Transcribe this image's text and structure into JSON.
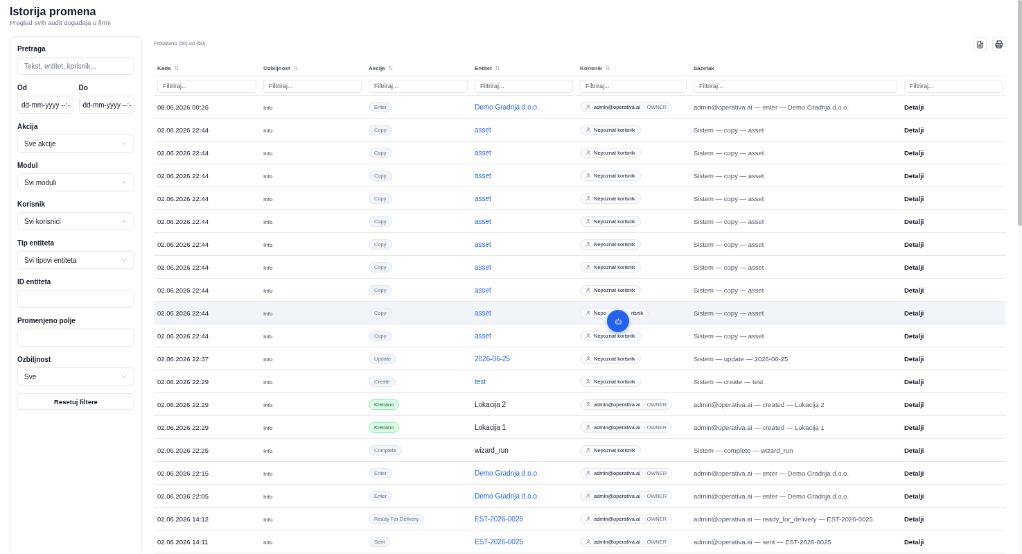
{
  "page": {
    "title": "Istorija promena",
    "subtitle": "Pregled svih audit događaja u firmi"
  },
  "filters": {
    "fields": [
      {
        "kind": "text",
        "label": "Pretraga",
        "placeholder": "Tekst, entitet, korisnik..."
      },
      {
        "kind": "date-pair",
        "items": [
          {
            "label": "Od",
            "value": "dd-mm-yyyy --:-"
          },
          {
            "label": "Do",
            "value": "dd-mm-yyyy --:-"
          }
        ]
      },
      {
        "kind": "select",
        "label": "Akcija",
        "value": "Sve akcije"
      },
      {
        "kind": "select",
        "label": "Modul",
        "value": "Svi moduli"
      },
      {
        "kind": "select",
        "label": "Korisnik",
        "value": "Svi korisnici"
      },
      {
        "kind": "select",
        "label": "Tip entiteta",
        "value": "Svi tipovi entiteta"
      },
      {
        "kind": "text",
        "label": "ID entiteta"
      },
      {
        "kind": "text",
        "label": "Promenjeno polje"
      },
      {
        "kind": "select",
        "label": "Ozbiljnost",
        "value": "Sve"
      }
    ],
    "reset_button": "Resetuj filtere"
  },
  "table": {
    "count_text": "Prikazano (50) od (50)",
    "columns": [
      {
        "label": "Kada",
        "sortable": true
      },
      {
        "label": "Ozbiljnost",
        "sortable": true
      },
      {
        "label": "Akcija",
        "sortable": true
      },
      {
        "label": "Entitet",
        "sortable": true
      },
      {
        "label": "Korisnik",
        "sortable": true
      },
      {
        "label": "Sažetak",
        "sortable": false
      }
    ],
    "filter_placeholders": [
      "Filtriraj...",
      "Filtriraj...",
      "Filtriraj...",
      "Filtriraj...",
      "Filtriraj...",
      "Filtriraj...",
      "Filtriraj..."
    ],
    "rows": [
      {
        "when": "08.06.2026 00:26",
        "severity": "Info",
        "action": {
          "label": "Enter",
          "color": "#f1f5f9"
        },
        "entity": {
          "text": "Demo Gradnja d.o.o.",
          "link": true
        },
        "user": "admin@operativa.ai",
        "role": "· OWNER",
        "summary": "admin@operativa.ai — enter — Demo Gradnja d.o.o.",
        "details": "Detalji",
        "hovered": false
      },
      {
        "when": "02.06.2026 22:44",
        "severity": "Info",
        "action": {
          "label": "Copy",
          "color": "#f1f5f9"
        },
        "entity": {
          "text": "asset",
          "link": true
        },
        "user": "Nepoznat korisnik",
        "summary": "Sistem — copy — asset",
        "details": "Detalji",
        "hovered": false
      },
      {
        "when": "02.06.2026 22:44",
        "severity": "Info",
        "action": {
          "label": "Copy",
          "color": "#f1f5f9"
        },
        "entity": {
          "text": "asset",
          "link": true
        },
        "user": "Nepoznat korisnik",
        "summary": "Sistem — copy — asset",
        "details": "Detalji",
        "hovered": false
      },
      {
        "when": "02.06.2026 22:44",
        "severity": "Info",
        "action": {
          "label": "Copy",
          "color": "#f1f5f9"
        },
        "entity": {
          "text": "asset",
          "link": true
        },
        "user": "Nepoznat korisnik",
        "summary": "Sistem — copy — asset",
        "details": "Detalji",
        "hovered": false
      },
      {
        "when": "02.06.2026 22:44",
        "severity": "Info",
        "action": {
          "label": "Copy",
          "color": "#f1f5f9"
        },
        "entity": {
          "text": "asset",
          "link": true
        },
        "user": "Nepoznat korisnik",
        "summary": "Sistem — copy — asset",
        "details": "Detalji",
        "hovered": false
      },
      {
        "when": "02.06.2026 22:44",
        "severity": "Info",
        "action": {
          "label": "Copy",
          "color": "#f1f5f9"
        },
        "entity": {
          "text": "asset",
          "link": true
        },
        "user": "Nepoznat korisnik",
        "summary": "Sistem — copy — asset",
        "details": "Detalji",
        "hovered": false
      },
      {
        "when": "02.06.2026 22:44",
        "severity": "Info",
        "action": {
          "label": "Copy",
          "color": "#f1f5f9"
        },
        "entity": {
          "text": "asset",
          "link": true
        },
        "user": "Nepoznat korisnik",
        "summary": "Sistem — copy — asset",
        "details": "Detalji",
        "hovered": false
      },
      {
        "when": "02.06.2026 22:44",
        "severity": "Info",
        "action": {
          "label": "Copy",
          "color": "#f1f5f9"
        },
        "entity": {
          "text": "asset",
          "link": true
        },
        "user": "Nepoznat korisnik",
        "summary": "Sistem — copy — asset",
        "details": "Detalji",
        "hovered": false
      },
      {
        "when": "02.06.2026 22:44",
        "severity": "Info",
        "action": {
          "label": "Copy",
          "color": "#f1f5f9"
        },
        "entity": {
          "text": "asset",
          "link": true
        },
        "user": "Nepoznat korisnik",
        "summary": "Sistem — copy — asset",
        "details": "Detalji",
        "hovered": false
      },
      {
        "when": "02.06.2026 22:44",
        "severity": "Info",
        "action": {
          "label": "Copy",
          "color": "#f1f5f9"
        },
        "entity": {
          "text": "asset",
          "link": true
        },
        "user": "Nepo",
        "user_end": "risnik",
        "summary": "Sistem — copy — asset",
        "details": "Detalji",
        "hovered": true
      },
      {
        "when": "02.06.2026 22:44",
        "severity": "Info",
        "action": {
          "label": "Copy",
          "color": "#f1f5f9"
        },
        "entity": {
          "text": "asset",
          "link": true
        },
        "user": "Nepoznat korisnik",
        "summary": "Sistem — copy — asset",
        "details": "Detalji",
        "hovered": false
      },
      {
        "when": "02.06.2026 22:37",
        "severity": "Info",
        "action": {
          "label": "Update",
          "color": "#f1f5f9"
        },
        "entity": {
          "text": "2026-06-25",
          "link": true
        },
        "user": "Nepoznat korisnik",
        "summary": "Sistem — update — 2026-06-25",
        "details": "Detalji",
        "hovered": false
      },
      {
        "when": "02.06.2026 22:29",
        "severity": "Info",
        "action": {
          "label": "Create",
          "color": "#f1f5f9"
        },
        "entity": {
          "text": "test",
          "link": true
        },
        "user": "Nepoznat korisnik",
        "summary": "Sistem — create — test",
        "details": "Detalji",
        "hovered": false
      },
      {
        "when": "02.06.2026 22:29",
        "severity": "Info",
        "action": {
          "label": "Kreirano",
          "color": "#dcfce7"
        },
        "entity": {
          "text": "Lokacija 2",
          "link": false
        },
        "user": "admin@operativa.ai",
        "role": "· OWNER",
        "summary": "admin@operativa.ai — created — Lokacija 2",
        "details": "Detalji",
        "hovered": false
      },
      {
        "when": "02.06.2026 22:29",
        "severity": "Info",
        "action": {
          "label": "Kreirano",
          "color": "#dcfce7"
        },
        "entity": {
          "text": "Lokacija 1",
          "link": false
        },
        "user": "admin@operativa.ai",
        "role": "· OWNER",
        "summary": "admin@operativa.ai — created — Lokacija 1",
        "details": "Detalji",
        "hovered": false
      },
      {
        "when": "02.06.2026 22:25",
        "severity": "Info",
        "action": {
          "label": "Complete",
          "color": "#f1f5f9"
        },
        "entity": {
          "text": "wizard_run",
          "link": false
        },
        "user": "Nepoznat korisnik",
        "summary": "Sistem — complete — wizard_run",
        "details": "Detalji",
        "hovered": false
      },
      {
        "when": "02.06.2026 22:15",
        "severity": "Info",
        "action": {
          "label": "Enter",
          "color": "#f1f5f9"
        },
        "entity": {
          "text": "Demo Gradnja d.o.o.",
          "link": true
        },
        "user": "admin@operativa.ai",
        "role": "· OWNER",
        "summary": "admin@operativa.ai — enter — Demo Gradnja d.o.o.",
        "details": "Detalji",
        "hovered": false
      },
      {
        "when": "02.06.2026 22:05",
        "severity": "Info",
        "action": {
          "label": "Enter",
          "color": "#f1f5f9"
        },
        "entity": {
          "text": "Demo Gradnja d.o.o.",
          "link": true
        },
        "user": "admin@operativa.ai",
        "role": "· OWNER",
        "summary": "admin@operativa.ai — enter — Demo Gradnja d.o.o.",
        "details": "Detalji",
        "hovered": false
      },
      {
        "when": "02.06.2026 14:12",
        "severity": "Info",
        "action": {
          "label": "Ready For Delivery",
          "color": "#f1f5f9"
        },
        "entity": {
          "text": "EST-2026-0025",
          "link": true
        },
        "user": "admin@operativa.ai",
        "role": "· OWNER",
        "summary": "admin@operativa.ai — ready_for_delivery — EST-2026-0025",
        "details": "Detalji",
        "hovered": false
      },
      {
        "when": "02.06.2026 14:11",
        "severity": "Info",
        "action": {
          "label": "Sent",
          "color": "#f1f5f9"
        },
        "entity": {
          "text": "EST-2026-0025",
          "link": true
        },
        "user": "admin@operativa.ai",
        "role": "· OWNER",
        "summary": "admin@operativa.ai — sent — EST-2026-0025",
        "details": "Detalji",
        "hovered": false
      }
    ]
  }
}
